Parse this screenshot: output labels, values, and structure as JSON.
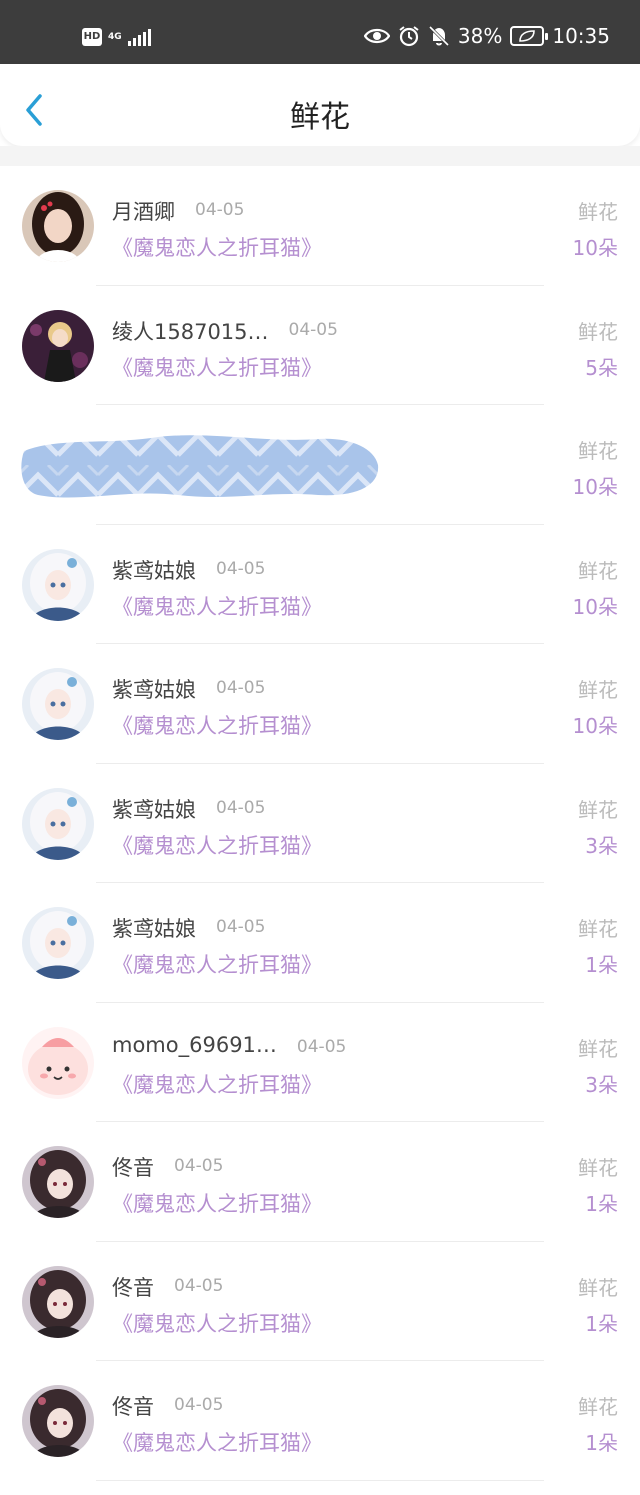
{
  "status_bar": {
    "hd": "HD",
    "network": "4G",
    "battery": "38%",
    "time": "10:35"
  },
  "header": {
    "title": "鲜花"
  },
  "rows": [
    {
      "name": "月酒卿",
      "date": "04-05",
      "book": "《魔鬼恋人之折耳猫》",
      "kind": "鲜花",
      "count": "10朵",
      "avatar": "girl-photo"
    },
    {
      "name": "绫人1587015…",
      "date": "04-05",
      "book": "《魔鬼恋人之折耳猫》",
      "kind": "鲜花",
      "count": "5朵",
      "avatar": "anime-boy"
    },
    {
      "name": "",
      "date": "",
      "book": "",
      "kind": "鲜花",
      "count": "10朵",
      "avatar": "redacted"
    },
    {
      "name": "紫鸢姑娘",
      "date": "04-05",
      "book": "《魔鬼恋人之折耳猫》",
      "kind": "鲜花",
      "count": "10朵",
      "avatar": "anime-girl-white"
    },
    {
      "name": "紫鸢姑娘",
      "date": "04-05",
      "book": "《魔鬼恋人之折耳猫》",
      "kind": "鲜花",
      "count": "10朵",
      "avatar": "anime-girl-white"
    },
    {
      "name": "紫鸢姑娘",
      "date": "04-05",
      "book": "《魔鬼恋人之折耳猫》",
      "kind": "鲜花",
      "count": "3朵",
      "avatar": "anime-girl-white"
    },
    {
      "name": "紫鸢姑娘",
      "date": "04-05",
      "book": "《魔鬼恋人之折耳猫》",
      "kind": "鲜花",
      "count": "1朵",
      "avatar": "anime-girl-white"
    },
    {
      "name": "momo_69691…",
      "date": "04-05",
      "book": "《魔鬼恋人之折耳猫》",
      "kind": "鲜花",
      "count": "3朵",
      "avatar": "pink-cartoon"
    },
    {
      "name": "佟音",
      "date": "04-05",
      "book": "《魔鬼恋人之折耳猫》",
      "kind": "鲜花",
      "count": "1朵",
      "avatar": "anime-girl-dark"
    },
    {
      "name": "佟音",
      "date": "04-05",
      "book": "《魔鬼恋人之折耳猫》",
      "kind": "鲜花",
      "count": "1朵",
      "avatar": "anime-girl-dark"
    },
    {
      "name": "佟音",
      "date": "04-05",
      "book": "《魔鬼恋人之折耳猫》",
      "kind": "鲜花",
      "count": "1朵",
      "avatar": "anime-girl-dark"
    }
  ],
  "colors": {
    "accent_purple": "#b58fd0",
    "back_blue": "#2a9fd6",
    "statusbar": "#3d3d3d"
  },
  "icons": [
    "back-arrow-icon",
    "eye-icon",
    "alarm-icon",
    "bell-muted-icon",
    "battery-icon",
    "signal-icon"
  ]
}
